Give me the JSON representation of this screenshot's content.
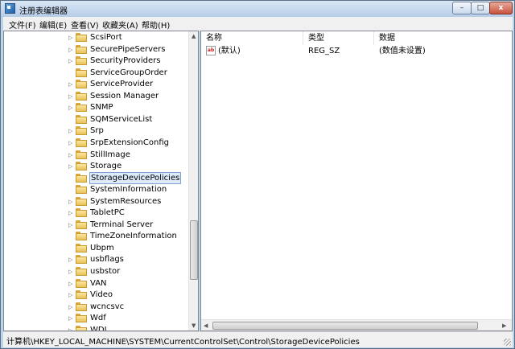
{
  "window": {
    "title": "注册表编辑器",
    "min_glyph": "–",
    "max_glyph": "□",
    "close_glyph": "x"
  },
  "menu": [
    {
      "label": "文件(F)"
    },
    {
      "label": "编辑(E)"
    },
    {
      "label": "查看(V)"
    },
    {
      "label": "收藏夹(A)"
    },
    {
      "label": "帮助(H)"
    }
  ],
  "tree": {
    "items": [
      {
        "label": "ScsiPort",
        "expandable": true
      },
      {
        "label": "SecurePipeServers",
        "expandable": true
      },
      {
        "label": "SecurityProviders",
        "expandable": true
      },
      {
        "label": "ServiceGroupOrder",
        "expandable": false
      },
      {
        "label": "ServiceProvider",
        "expandable": true
      },
      {
        "label": "Session Manager",
        "expandable": true
      },
      {
        "label": "SNMP",
        "expandable": true
      },
      {
        "label": "SQMServiceList",
        "expandable": false
      },
      {
        "label": "Srp",
        "expandable": true
      },
      {
        "label": "SrpExtensionConfig",
        "expandable": true
      },
      {
        "label": "StillImage",
        "expandable": true
      },
      {
        "label": "Storage",
        "expandable": true
      },
      {
        "label": "StorageDevicePolicies",
        "expandable": false,
        "selected": true
      },
      {
        "label": "SystemInformation",
        "expandable": false
      },
      {
        "label": "SystemResources",
        "expandable": true
      },
      {
        "label": "TabletPC",
        "expandable": true
      },
      {
        "label": "Terminal Server",
        "expandable": true
      },
      {
        "label": "TimeZoneInformation",
        "expandable": false
      },
      {
        "label": "Ubpm",
        "expandable": false
      },
      {
        "label": "usbflags",
        "expandable": true
      },
      {
        "label": "usbstor",
        "expandable": true
      },
      {
        "label": "VAN",
        "expandable": true
      },
      {
        "label": "Video",
        "expandable": true
      },
      {
        "label": "wcncsvc",
        "expandable": true
      },
      {
        "label": "Wdf",
        "expandable": true
      },
      {
        "label": "WDI",
        "expandable": true
      }
    ]
  },
  "values": {
    "columns": [
      "名称",
      "类型",
      "数据"
    ],
    "rows": [
      {
        "name": "(默认)",
        "type": "REG_SZ",
        "data": "(数值未设置)",
        "icon": "ab-icon"
      }
    ]
  },
  "status": {
    "path": "计算机\\HKEY_LOCAL_MACHINE\\SYSTEM\\CurrentControlSet\\Control\\StorageDevicePolicies"
  },
  "colors": {
    "selection": "#dceaf9",
    "selection_border": "#7da2ce",
    "folder": "#e8c15a"
  }
}
